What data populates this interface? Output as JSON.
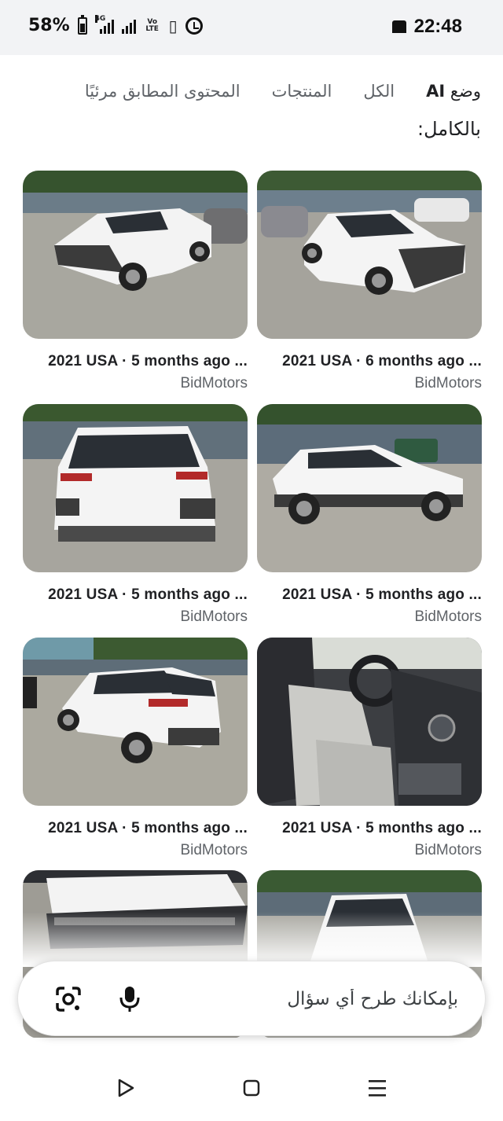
{
  "status_bar": {
    "battery": "58%",
    "network": "4G",
    "volte": "Vo LTE",
    "time": "22:48"
  },
  "tabs": [
    {
      "label": "وضع",
      "ai": "AI",
      "active": true
    },
    {
      "label": "الكل",
      "active": false
    },
    {
      "label": "المنتجات",
      "active": false
    },
    {
      "label": "المحتوى المطابق مرئيًا",
      "active": false
    }
  ],
  "heading": "بالكامل:",
  "results": [
    {
      "caption": "2021 USA · 6 months ago ...",
      "source": "BidMotors",
      "image": "damaged-white-suv-front-right"
    },
    {
      "caption": "2021 USA · 5 months ago ...",
      "source": "BidMotors",
      "image": "damaged-white-suv-front-left"
    },
    {
      "caption": "2021 USA · 5 months ago ...",
      "source": "BidMotors",
      "image": "white-suv-side"
    },
    {
      "caption": "2021 USA · 5 months ago ...",
      "source": "BidMotors",
      "image": "white-suv-rear"
    },
    {
      "caption": "2021 USA · 5 months ago ...",
      "source": "BidMotors",
      "image": "suv-interior-seats"
    },
    {
      "caption": "2021 USA · 5 months ago ...",
      "source": "BidMotors",
      "image": "white-suv-rear-angle"
    },
    {
      "image": "white-suv-front-lot"
    },
    {
      "image": "damaged-hood-closeup"
    }
  ],
  "search": {
    "placeholder": "بإمكانك طرح أي سؤال"
  },
  "icons": {
    "lens": "google-lens-icon",
    "mic": "microphone-icon",
    "back": "back-triangle-icon",
    "home": "home-square-icon",
    "recents": "recents-lines-icon"
  },
  "colors": {
    "background": "#ffffff",
    "status_bar": "#f2f3f5",
    "text_primary": "#202124",
    "text_secondary": "#5f6368"
  }
}
